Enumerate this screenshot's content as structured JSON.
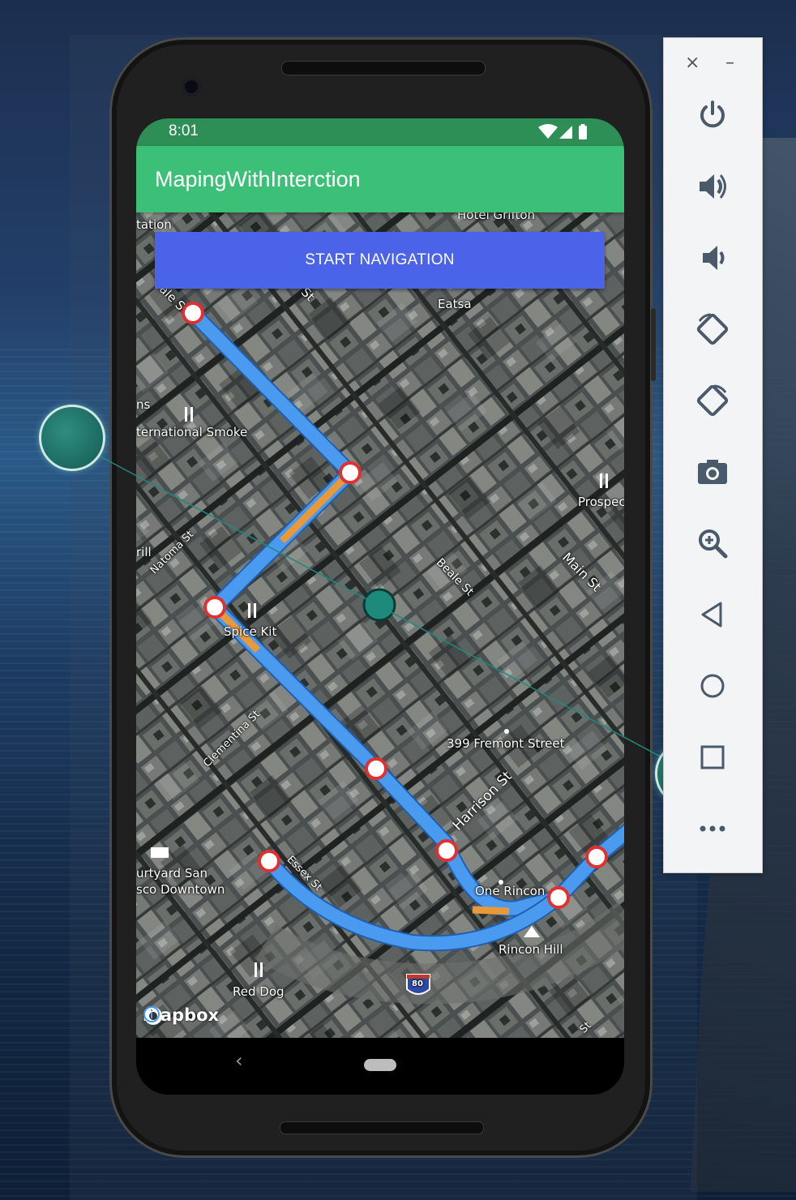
{
  "device": {
    "status_time": "8:01",
    "app_title": "MapingWithInterction",
    "start_button_label": "START NAVIGATION"
  },
  "map": {
    "labels": {
      "hotel_grifton": "Hotel Grifton",
      "tation": "tation",
      "eatsa": "Eatsa",
      "beale_s": "ale S",
      "st_top": "St",
      "ns": "ns",
      "international_smoke": "ternational Smoke",
      "prospect": "Prospec",
      "rill": "rill",
      "natoma_st": "Natoma St",
      "beale_st": "Beale St",
      "main_st": "Main St",
      "spice_kit": "Spice Kit",
      "clementina_st": "Clementina St",
      "fremont_street": "399 Fremont Street",
      "harrison_st": "Harrison St",
      "courtyard_1": "urtyard San",
      "courtyard_2": "sco Downtown",
      "essex_st": "Essex St",
      "one_rincon": "One Rincon",
      "rincon_hill": "Rincon Hill",
      "red_dog": "Red Dog",
      "highway": "80",
      "st_bottom": "St"
    },
    "attribution": "mapbox",
    "icons": [
      "restaurant-icon",
      "hotel-icon",
      "landmark-icon",
      "interstate-shield-icon",
      "info-icon"
    ]
  },
  "toolbar": {
    "close": "×",
    "minimize": "–",
    "buttons": [
      "power-icon",
      "volume-up-icon",
      "volume-down-icon",
      "rotate-left-icon",
      "rotate-right-icon",
      "camera-icon",
      "zoom-icon",
      "back-icon",
      "home-icon",
      "overview-icon",
      "more-icon"
    ]
  },
  "colors": {
    "status_bar": "#2d8f56",
    "app_bar": "#3cbf76",
    "button": "#4a63e8",
    "route": "#4a9af0",
    "route_highlight": "#e8993a",
    "waypoint_ring": "#e03030"
  }
}
